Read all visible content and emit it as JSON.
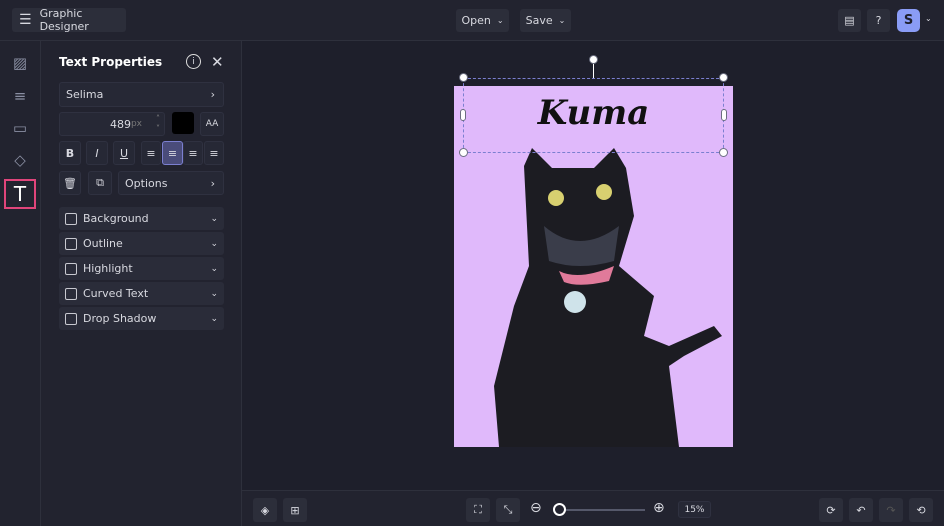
{
  "app": {
    "title": "Graphic Designer"
  },
  "toolbar": {
    "open": "Open",
    "save": "Save",
    "avatar": "S"
  },
  "panel": {
    "title": "Text Properties",
    "font": "Selima",
    "size": "489",
    "unit": "px",
    "options": "Options",
    "sections": [
      "Background",
      "Outline",
      "Highlight",
      "Curved Text",
      "Drop Shadow"
    ]
  },
  "canvas": {
    "text": "Kuma",
    "bg": "#e0b9fb"
  },
  "bottom": {
    "zoom": "15%",
    "zoom_fraction": 0.0
  },
  "colors": {
    "accent": "#e0457b",
    "active": "#4a4c7a"
  }
}
